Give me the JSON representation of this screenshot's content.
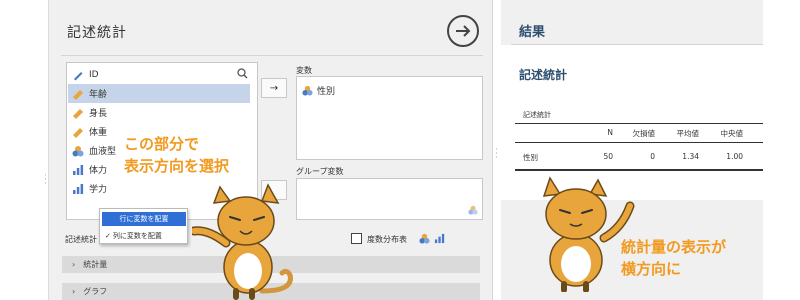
{
  "left_panel": {
    "title": "記述統計",
    "variables": [
      {
        "name": "ID",
        "icon": "id-icon"
      },
      {
        "name": "年齢",
        "icon": "continuous-icon",
        "selected": true
      },
      {
        "name": "身長",
        "icon": "continuous-icon"
      },
      {
        "name": "体重",
        "icon": "continuous-icon"
      },
      {
        "name": "血液型",
        "icon": "nominal-icon"
      },
      {
        "name": "体力",
        "icon": "ordinal-icon"
      },
      {
        "name": "学力",
        "icon": "ordinal-icon"
      }
    ],
    "move_arrow": "→",
    "variables_box": {
      "label": "変数",
      "items": [
        "性別"
      ]
    },
    "group_box": {
      "label": "グループ変数",
      "items": []
    },
    "split_label": "記述統計",
    "popup": {
      "option1": "行に変数を配置",
      "option2": "列に変数を配置",
      "checkmark": "✓"
    },
    "frequency_table": {
      "label": "度数分布表",
      "checked": false
    },
    "sections": [
      "統計量",
      "グラフ"
    ]
  },
  "results": {
    "header": "結果",
    "heading": "記述統計",
    "table_title": "記述統計",
    "columns": [
      "",
      "N",
      "欠損値",
      "平均値",
      "中央値"
    ],
    "rows": [
      [
        "性別",
        "50",
        "0",
        "1.34",
        "1.00"
      ]
    ]
  },
  "annotations": {
    "left_line1": "この部分で",
    "left_line2": "表示方向を選択",
    "right_line1": "統計量の表示が",
    "right_line2": "横方向に"
  },
  "colors": {
    "accent_orange": "#f29a1f",
    "selection_blue": "#c5d4e8",
    "popup_highlight": "#2f6fd6",
    "results_heading": "#2f4f6f"
  }
}
